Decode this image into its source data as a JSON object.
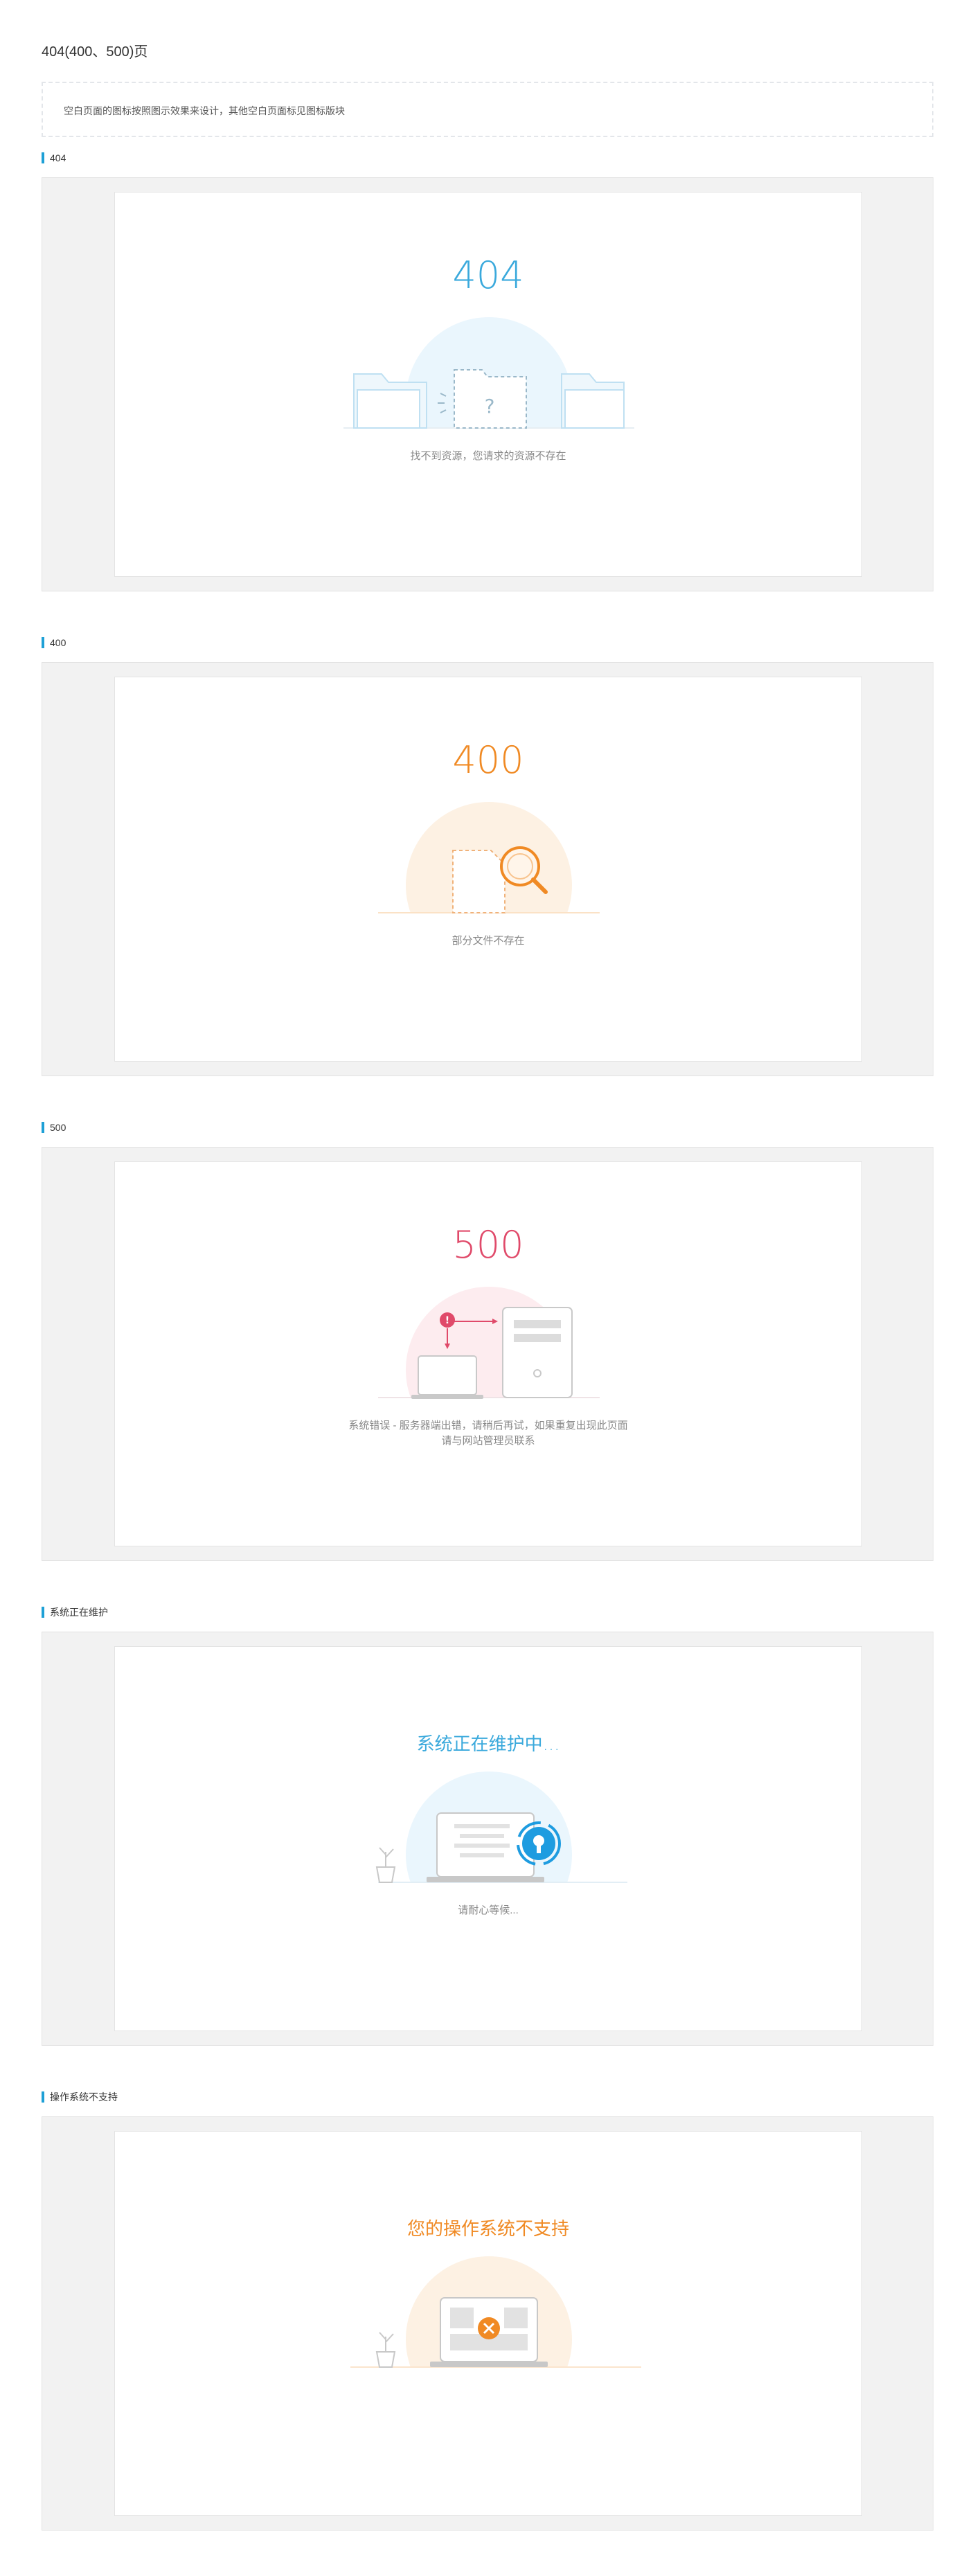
{
  "page": {
    "title": "404(400、500)页",
    "notice": "空白页面的图标按照图示效果来设计，其他空白页面标见图标版块"
  },
  "sections": [
    {
      "label": "404",
      "heading": "404",
      "message": "找不到资源，您请求的资源不存在",
      "color": "#3aa9dc",
      "icon": "missing-folder-illustration"
    },
    {
      "label": "400",
      "heading": "400",
      "message": "部分文件不存在",
      "color": "#f08a24",
      "icon": "file-search-illustration"
    },
    {
      "label": "500",
      "heading": "500",
      "message_lines": [
        "系统错误 - 服务器端出错，请稍后再试，如果重复出现此页面",
        "请与网站管理员联系"
      ],
      "color": "#e04a6a",
      "icon": "server-error-illustration"
    },
    {
      "label": "系统正在维护",
      "heading": "系统正在维护中...",
      "message": "请耐心等候...",
      "color": "#3aa9dc",
      "icon": "laptop-maintenance-illustration"
    },
    {
      "label": "操作系统不支持",
      "heading": "您的操作系统不支持",
      "message": "",
      "color": "#f08a24",
      "icon": "laptop-unsupported-illustration"
    }
  ]
}
